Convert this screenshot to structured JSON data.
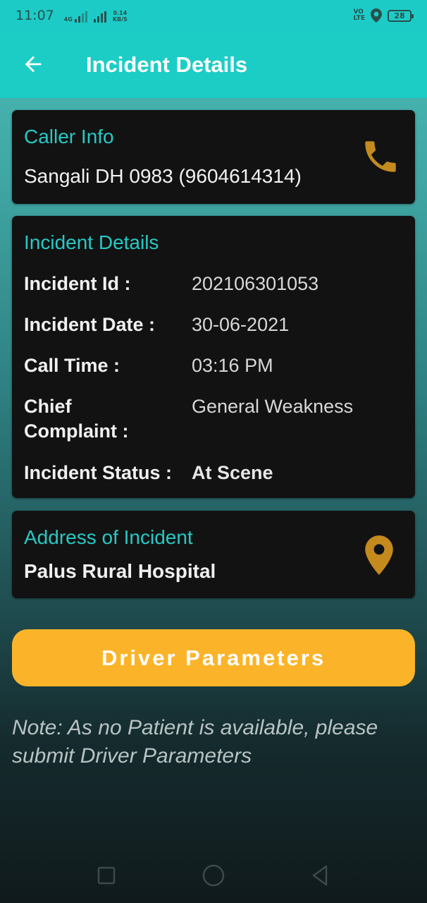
{
  "status_bar": {
    "time": "11:07",
    "network_tag": "4G",
    "speed_value": "0.14",
    "speed_unit": "KB/S",
    "volte_top": "VO",
    "volte_bottom": "LTE",
    "battery": "28",
    "icons": [
      "signal-icon",
      "location-icon",
      "battery-icon"
    ]
  },
  "app_bar": {
    "title": "Incident Details",
    "back_icon": "arrow-left-icon"
  },
  "caller_info": {
    "title": "Caller Info",
    "caller": "Sangali DH  0983 (9604614314)",
    "icon": "phone-icon",
    "icon_color": "#c48a1e"
  },
  "incident": {
    "title": "Incident Details",
    "rows": [
      {
        "label": "Incident Id :",
        "value": "202106301053"
      },
      {
        "label": "Incident Date :",
        "value": "30-06-2021"
      },
      {
        "label": "Call Time :",
        "value": "03:16 PM"
      },
      {
        "label": "Chief Complaint :",
        "label_line1": "Chief",
        "label_line2": "Complaint :",
        "value": "General Weakness"
      },
      {
        "label": "Incident Status :",
        "value": "At Scene"
      }
    ]
  },
  "address": {
    "title": "Address of Incident",
    "value": "Palus Rural Hospital",
    "icon": "map-pin-icon",
    "icon_color": "#c48a1e"
  },
  "driver_button": {
    "label": "Driver Parameters",
    "color": "#fbb429"
  },
  "note": "Note: As no Patient is available, please submit Driver Parameters",
  "nav_bar": {
    "icons": [
      "recent-apps-icon",
      "home-icon",
      "back-triangle-icon"
    ]
  },
  "colors": {
    "accent": "#1ccdc6",
    "card_title": "#27c9c5",
    "card_bg": "#121212"
  }
}
